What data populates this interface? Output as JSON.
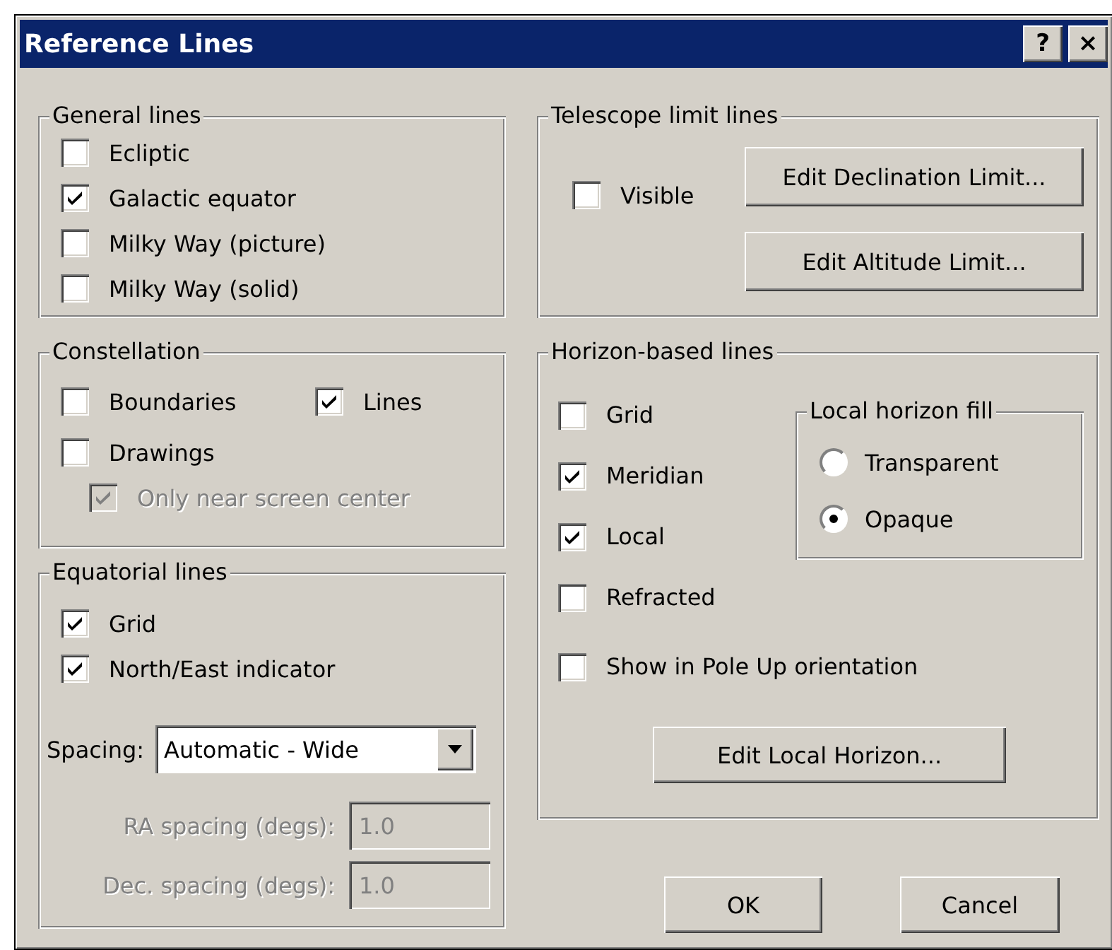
{
  "window": {
    "title": "Reference Lines",
    "help_button": "?",
    "close_button": "×"
  },
  "general_lines": {
    "title": "General lines",
    "items": [
      {
        "label": "Ecliptic",
        "checked": false
      },
      {
        "label": "Galactic equator",
        "checked": true
      },
      {
        "label": "Milky Way (picture)",
        "checked": false
      },
      {
        "label": "Milky Way (solid)",
        "checked": false
      }
    ]
  },
  "constellation": {
    "title": "Constellation",
    "items": [
      {
        "label": "Boundaries",
        "checked": false,
        "disabled": false
      },
      {
        "label": "Lines",
        "checked": true,
        "disabled": false
      },
      {
        "label": "Drawings",
        "checked": false,
        "disabled": false
      },
      {
        "label": "Only near screen center",
        "checked": true,
        "disabled": true
      }
    ]
  },
  "equatorial_lines": {
    "title": "Equatorial lines",
    "items": [
      {
        "label": "Grid",
        "checked": true
      },
      {
        "label": "North/East indicator",
        "checked": true
      }
    ],
    "spacing": {
      "label": "Spacing:",
      "value": "Automatic - Wide"
    },
    "fields": [
      {
        "label": "RA spacing (degs):",
        "value": "1.0",
        "disabled": true
      },
      {
        "label": "Dec. spacing (degs):",
        "value": "1.0",
        "disabled": true
      }
    ]
  },
  "telescope_limit_lines": {
    "title": "Telescope limit lines",
    "visible": {
      "label": "Visible",
      "checked": false
    },
    "buttons": [
      "Edit Declination Limit...",
      "Edit Altitude Limit..."
    ]
  },
  "horizon_based_lines": {
    "title": "Horizon-based lines",
    "items": [
      {
        "label": "Grid",
        "checked": false
      },
      {
        "label": "Meridian",
        "checked": true
      },
      {
        "label": "Local",
        "checked": true
      },
      {
        "label": "Refracted",
        "checked": false
      }
    ],
    "fill": {
      "title": "Local horizon fill",
      "options": [
        {
          "label": "Transparent",
          "selected": false
        },
        {
          "label": "Opaque",
          "selected": true
        }
      ]
    },
    "pole_up": {
      "label": "Show in Pole Up orientation",
      "checked": false
    },
    "button": "Edit Local Horizon..."
  },
  "buttons": [
    "OK",
    "Cancel"
  ]
}
